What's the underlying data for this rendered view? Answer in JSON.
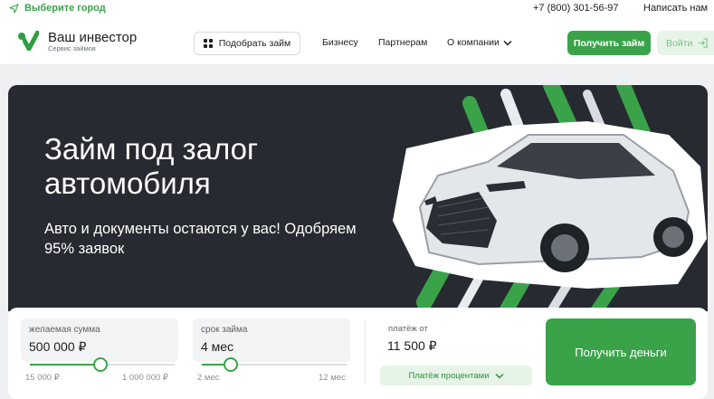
{
  "topbar": {
    "city_label": "Выберите город",
    "phone": "+7 (800) 301-56-97",
    "write_label": "Написать нам"
  },
  "header": {
    "logo_title": "Ваш инвестор",
    "logo_subtitle": "Сервис займов",
    "pick_loan_label": "Подобрать займ",
    "nav": [
      "Бизнесу",
      "Партнерам",
      "О компании"
    ],
    "get_loan_label": "Получить займ",
    "login_label": "Войти"
  },
  "hero": {
    "title": "Займ под залог автомобиля",
    "subtitle": "Авто и документы остаются у вас! Одобряем 95% заявок"
  },
  "calculator": {
    "amount": {
      "label": "желаемая сумма",
      "value": "500 000 ₽",
      "min_label": "15 000 ₽",
      "max_label": "1 000 000 ₽",
      "slider_fraction": 0.49
    },
    "term": {
      "label": "срок займа",
      "value": "4 мес",
      "min_label": "2 мес",
      "max_label": "12 мес",
      "slider_fraction": 0.2
    },
    "payment_label": "платёж от",
    "payment_value": "11 500 ₽",
    "percent_button_label": "Платёж процентами",
    "submit_label": "Получить деньги"
  },
  "colors": {
    "brand_green": "#3aa34a",
    "hero_bg": "#272a30",
    "light_green": "#e6f4e8"
  },
  "icons": [
    "location-arrow-icon",
    "logo-check-icon",
    "grid-icon",
    "chevron-down-icon",
    "login-icon"
  ]
}
